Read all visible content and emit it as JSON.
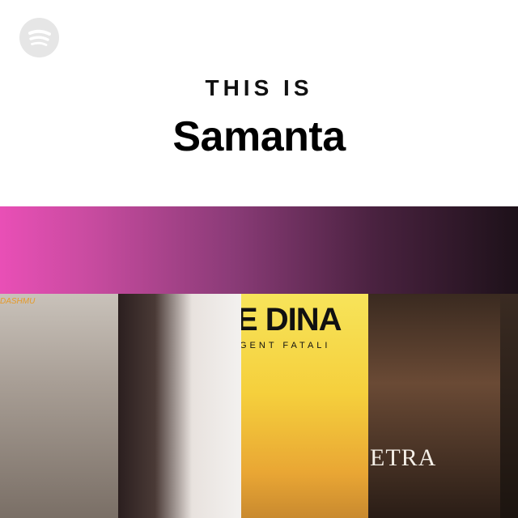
{
  "header": {
    "eyebrow": "THIS IS",
    "title": "Samanta"
  },
  "logo": {
    "icon": "spotify-logo-icon"
  },
  "covers": [
    {
      "label": "DASHMU"
    },
    {
      "label": ""
    },
    {
      "label": "E DINA",
      "sublabel": "GENT FATALI"
    },
    {
      "label": "ETRA"
    },
    {
      "label": ""
    }
  ],
  "colors": {
    "gradient_start": "#e94fb6",
    "gradient_end": "#1d1119"
  }
}
